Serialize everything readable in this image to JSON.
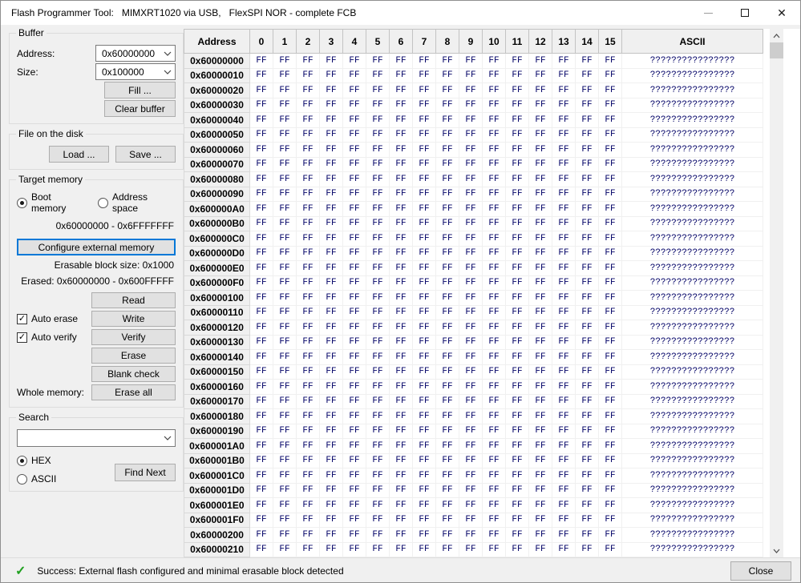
{
  "window": {
    "title": "Flash Programmer Tool:   MIMXRT1020 via USB,   FlexSPI NOR - complete FCB"
  },
  "buffer": {
    "label": "Buffer",
    "address_label": "Address:",
    "address_value": "0x60000000",
    "size_label": "Size:",
    "size_value": "0x100000",
    "fill_button": "Fill ...",
    "clear_button": "Clear buffer"
  },
  "file": {
    "label": "File on the disk",
    "load_button": "Load ...",
    "save_button": "Save ..."
  },
  "target": {
    "label": "Target memory",
    "boot_memory_radio": "Boot memory",
    "address_space_radio": "Address space",
    "memory_range": "0x60000000 - 0x6FFFFFFF",
    "configure_button": "Configure external memory",
    "erasable_text": "Erasable block size: 0x1000",
    "erased_text": "Erased: 0x60000000 - 0x600FFFFF",
    "read_button": "Read",
    "write_button": "Write",
    "verify_button": "Verify",
    "erase_button": "Erase",
    "blank_check_button": "Blank check",
    "erase_all_button": "Erase all",
    "auto_erase_label": "Auto erase",
    "auto_verify_label": "Auto verify",
    "whole_memory_label": "Whole memory:"
  },
  "search": {
    "label": "Search",
    "value": "",
    "hex_radio": "HEX",
    "ascii_radio": "ASCII",
    "find_button": "Find Next"
  },
  "hex_table": {
    "headers": {
      "address": "Address",
      "columns": [
        "0",
        "1",
        "2",
        "3",
        "4",
        "5",
        "6",
        "7",
        "8",
        "9",
        "10",
        "11",
        "12",
        "13",
        "14",
        "15"
      ],
      "ascii": "ASCII"
    },
    "byte_value": "FF",
    "ascii_value": "????????????????",
    "rows": [
      "0x60000000",
      "0x60000010",
      "0x60000020",
      "0x60000030",
      "0x60000040",
      "0x60000050",
      "0x60000060",
      "0x60000070",
      "0x60000080",
      "0x60000090",
      "0x600000A0",
      "0x600000B0",
      "0x600000C0",
      "0x600000D0",
      "0x600000E0",
      "0x600000F0",
      "0x60000100",
      "0x60000110",
      "0x60000120",
      "0x60000130",
      "0x60000140",
      "0x60000150",
      "0x60000160",
      "0x60000170",
      "0x60000180",
      "0x60000190",
      "0x600001A0",
      "0x600001B0",
      "0x600001C0",
      "0x600001D0",
      "0x600001E0",
      "0x600001F0",
      "0x60000200",
      "0x60000210"
    ]
  },
  "status": {
    "message": "Success: External flash configured and minimal erasable block detected",
    "close_button": "Close"
  },
  "icons": {
    "success_check": "✓",
    "close_x": "✕",
    "checkbox_check": "✓"
  },
  "colors": {
    "success_green": "#21a121",
    "focus_blue": "#0078d7",
    "hex_text_navy": "#000066"
  }
}
